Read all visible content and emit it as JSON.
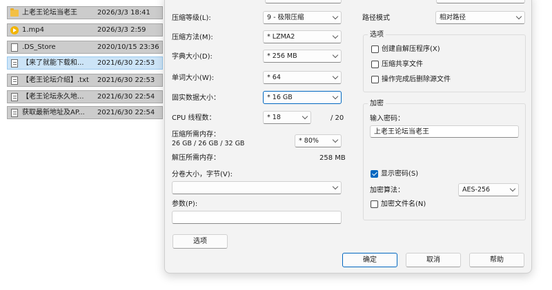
{
  "files": [
    {
      "icon": "folder-icon",
      "name": "上老王论坛当老王",
      "date": "2026/3/3 18:41"
    },
    {
      "icon": "video-file-icon",
      "name": "1.mp4",
      "date": "2026/3/3 2:59"
    },
    {
      "icon": "file-icon",
      "name": ".DS_Store",
      "date": "2020/10/15 23:36"
    },
    {
      "icon": "text-file-icon",
      "name": "【来了就能下载和...",
      "date": "2021/6/30 22:53"
    },
    {
      "icon": "text-file-icon",
      "name": "【老王论坛介绍】.txt",
      "date": "2021/6/30 22:53"
    },
    {
      "icon": "text-file-icon",
      "name": "【老王论坛永久地...",
      "date": "2021/6/30 22:54"
    },
    {
      "icon": "text-file-icon",
      "name": "获取最新地址及AP...",
      "date": "2021/6/30 22:54"
    }
  ],
  "compression": {
    "level_label": "压缩等级(L):",
    "level_value": "9 - 极限压缩",
    "method_label": "压缩方法(M):",
    "method_value": "* LZMA2",
    "dict_label": "字典大小(D):",
    "dict_value": "* 256 MB",
    "word_label": "单词大小(W):",
    "word_value": "* 64",
    "solid_label": "固实数据大小：",
    "solid_value": "* 16 GB",
    "threads_label": "CPU 线程数：",
    "threads_value": "* 18",
    "threads_max": "/ 20",
    "mem_label": "压缩所需内存：",
    "mem_detail": "26 GB / 26 GB / 32 GB",
    "mem_percent": "* 80%",
    "decomp_label": "解压所需内存：",
    "decomp_value": "258 MB",
    "split_label": "分卷大小，字节(V):",
    "split_value": "",
    "params_label": "参数(P):",
    "params_value": "",
    "options_button": "选项"
  },
  "right": {
    "path_mode_label": "路径模式",
    "path_mode_value": "相对路径",
    "options_group": "选项",
    "opt_sfx": "创建自解压程序(X)",
    "opt_shared": "压缩共享文件",
    "opt_delete": "操作完成后删除源文件",
    "encrypt_group": "加密",
    "password_label": "输入密码：",
    "password_value": "上老王论坛当老王",
    "show_password": "显示密码(S)",
    "enc_method_label": "加密算法：",
    "enc_method_value": "AES-256",
    "encrypt_names": "加密文件名(N)"
  },
  "buttons": {
    "ok": "确定",
    "cancel": "取消",
    "help": "帮助"
  },
  "colors": {
    "accent": "#0067c0",
    "row_selected": "#cce4f7",
    "row_normal": "#cccccc"
  }
}
